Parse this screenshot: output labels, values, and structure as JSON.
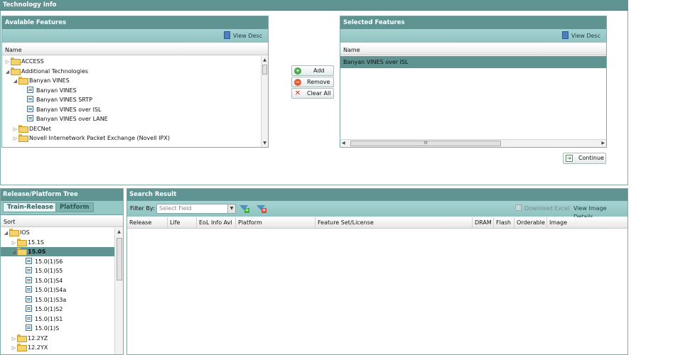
{
  "tech_info": {
    "title": "Technology Info"
  },
  "available": {
    "title": "Avalable Features",
    "view_desc": "View Desc",
    "col_name": "Name",
    "items": [
      {
        "label": "ACCESS",
        "expander": "▷",
        "type": "folder"
      },
      {
        "label": "Additional Technologies",
        "expander": "◢",
        "type": "folder"
      },
      {
        "label": "Banyan VINES",
        "expander": "◢",
        "type": "folder"
      },
      {
        "label": "Banyan VINES",
        "expander": "",
        "type": "leaf"
      },
      {
        "label": "Banyan VINES SRTP",
        "expander": "",
        "type": "leaf"
      },
      {
        "label": "Banyan VINES over ISL",
        "expander": "",
        "type": "leaf"
      },
      {
        "label": "Banyan VINES over LANE",
        "expander": "",
        "type": "leaf"
      },
      {
        "label": "DECNet",
        "expander": "▷",
        "type": "folder"
      },
      {
        "label": "Novell Internetwork Packet Exchange (Novell IPX)",
        "expander": "▷",
        "type": "folder"
      }
    ]
  },
  "actions": {
    "add": "Add",
    "remove": "Remove",
    "clear_all": "Clear All"
  },
  "selected": {
    "title": "Selected Features",
    "view_desc": "View Desc",
    "col_name": "Name",
    "items": [
      {
        "label": "Banyan VINES over ISL"
      }
    ],
    "hscroll_grip": "III"
  },
  "continue_label": "Continue",
  "release_tree": {
    "title": "Release/Platform Tree",
    "tabs": [
      "Train-Release",
      "Platform"
    ],
    "sort_label": "Sort",
    "items": [
      {
        "label": "IOS",
        "expander": "◢",
        "type": "folder"
      },
      {
        "label": "15.1S",
        "expander": "▷",
        "type": "folder"
      },
      {
        "label": "15.0S",
        "expander": "◢",
        "type": "folder",
        "selected": true
      },
      {
        "label": "15.0(1)S6",
        "expander": "",
        "type": "leaf"
      },
      {
        "label": "15.0(1)S5",
        "expander": "",
        "type": "leaf"
      },
      {
        "label": "15.0(1)S4",
        "expander": "",
        "type": "leaf"
      },
      {
        "label": "15.0(1)S4a",
        "expander": "",
        "type": "leaf"
      },
      {
        "label": "15.0(1)S3a",
        "expander": "",
        "type": "leaf"
      },
      {
        "label": "15.0(1)S2",
        "expander": "",
        "type": "leaf"
      },
      {
        "label": "15.0(1)S1",
        "expander": "",
        "type": "leaf"
      },
      {
        "label": "15.0(1)S",
        "expander": "",
        "type": "leaf"
      },
      {
        "label": "12.2YZ",
        "expander": "▷",
        "type": "folder"
      },
      {
        "label": "12.2YX",
        "expander": "▷",
        "type": "folder"
      }
    ]
  },
  "search_result": {
    "title": "Search Result",
    "filter_by": "Filter By:",
    "select_field_placeholder": "Select Field",
    "download_excel": "Download Excel",
    "view_image_details": "View Image Details",
    "columns": [
      "Release",
      "Life Cycle",
      "EoL Info Avl",
      "Platform",
      "Feature Set/License",
      "DRAM",
      "Flash",
      "Orderable",
      "Image"
    ]
  },
  "colors": {
    "header": "#5f9492",
    "toolbar": "#96c8c6",
    "selection": "#5f9492",
    "border": "#7fa9a7"
  }
}
